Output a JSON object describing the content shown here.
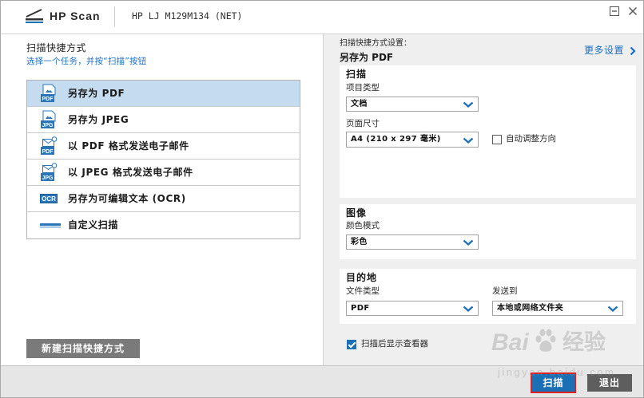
{
  "window": {
    "logo_icon": "hp-scan-logo-icon",
    "app_name": "HP Scan",
    "device_name": "HP LJ M129M134 (NET)",
    "minimize_icon": "minimize-icon",
    "close_icon": "close-icon"
  },
  "shortcuts": {
    "title": "扫描快捷方式",
    "hint": "选择一个任务，并按“扫描”按钮",
    "items": [
      {
        "label": "另存为 PDF",
        "icon": "pdf-document-icon",
        "icon_label": "PDF",
        "selected": true
      },
      {
        "label": "另存为 JPEG",
        "icon": "jpeg-document-icon",
        "icon_label": "JPG",
        "selected": false
      },
      {
        "label": "以 PDF 格式发送电子邮件",
        "icon": "pdf-email-icon",
        "icon_label": "PDF",
        "selected": false
      },
      {
        "label": "以 JPEG 格式发送电子邮件",
        "icon": "jpeg-email-icon",
        "icon_label": "JPG",
        "selected": false
      },
      {
        "label": "另存为可编辑文本 (OCR)",
        "icon": "ocr-icon",
        "icon_label": "OCR",
        "selected": false
      },
      {
        "label": "自定义扫描",
        "icon": "custom-scan-icon",
        "selected": false
      }
    ],
    "new_shortcut_button": "新建扫描快捷方式"
  },
  "settings": {
    "caption": "扫描快捷方式设置：",
    "current_shortcut": "另存为 PDF",
    "more_settings": "更多设置",
    "more_settings_icon": "chevron-right-icon",
    "select_arrow_icon": "chevron-down-icon",
    "scan": {
      "title": "扫描",
      "item_type": {
        "label": "项目类型",
        "value": "文档"
      },
      "page_size": {
        "label": "页面尺寸",
        "value": "A4 (210 x 297 毫米)"
      },
      "auto_orient": {
        "label": "自动调整方向",
        "checked": false
      }
    },
    "image": {
      "title": "图像",
      "color_mode": {
        "label": "颜色模式",
        "value": "彩色"
      }
    },
    "destination": {
      "title": "目的地",
      "file_type": {
        "label": "文件类型",
        "value": "PDF"
      },
      "send_to": {
        "label": "发送到",
        "value": "本地或网络文件夹"
      }
    },
    "show_viewer": {
      "label": "扫描后显示查看器",
      "checked": true
    }
  },
  "footer": {
    "scan_button": "扫描",
    "exit_button": "退出"
  },
  "watermark": {
    "brand": "Bai",
    "brand_icon": "baidu-paw-icon",
    "brand_suffix": "经验",
    "url": "jingyan.baidu.com"
  },
  "colors": {
    "accent": "#1a6fb5",
    "link": "#1b6fc2",
    "selected_row": "#c5dbf0",
    "pane_background": "#efefef",
    "new_button": "#7a7a7a",
    "exit_button": "#5e5e5e",
    "annotation_outline": "#e0201c"
  }
}
